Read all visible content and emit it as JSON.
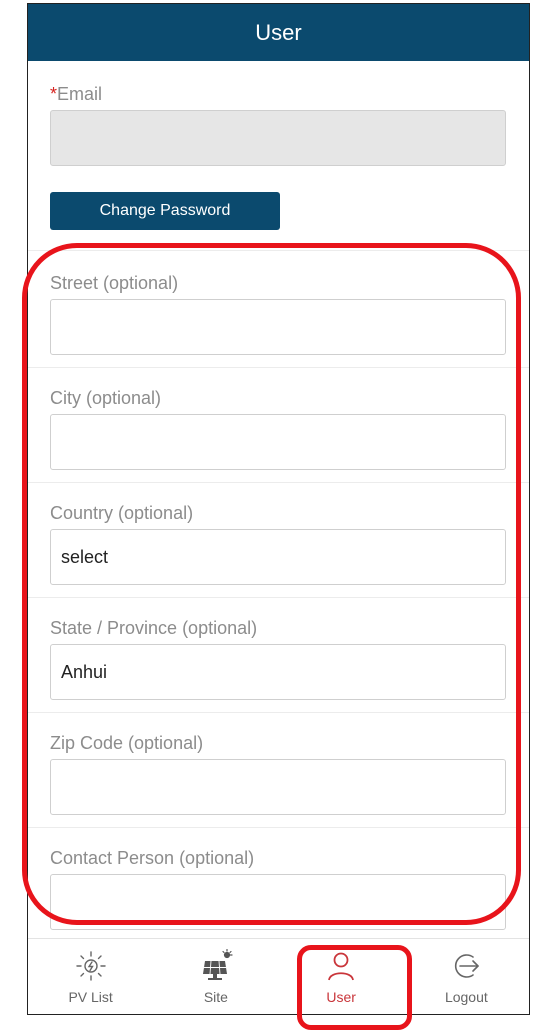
{
  "header": {
    "title": "User"
  },
  "form": {
    "email": {
      "required_mark": "*",
      "label": "Email",
      "value": ""
    },
    "change_password_label": "Change Password",
    "street": {
      "label": "Street (optional)",
      "value": ""
    },
    "city": {
      "label": "City (optional)",
      "value": ""
    },
    "country": {
      "label": "Country (optional)",
      "value": "select"
    },
    "state": {
      "label": "State / Province (optional)",
      "value": "Anhui"
    },
    "zip": {
      "label": "Zip Code (optional)",
      "value": ""
    },
    "contact": {
      "label": "Contact Person (optional)",
      "value": ""
    }
  },
  "tabbar": {
    "tabs": [
      {
        "label": "PV List",
        "icon": "pv-list-icon"
      },
      {
        "label": "Site",
        "icon": "solar-panel-icon"
      },
      {
        "label": "User",
        "icon": "user-icon",
        "active": true
      },
      {
        "label": "Logout",
        "icon": "logout-icon"
      }
    ]
  },
  "colors": {
    "header": "#0b4a6e",
    "active_tab": "#c9353a",
    "annotation": "#e8141b"
  }
}
